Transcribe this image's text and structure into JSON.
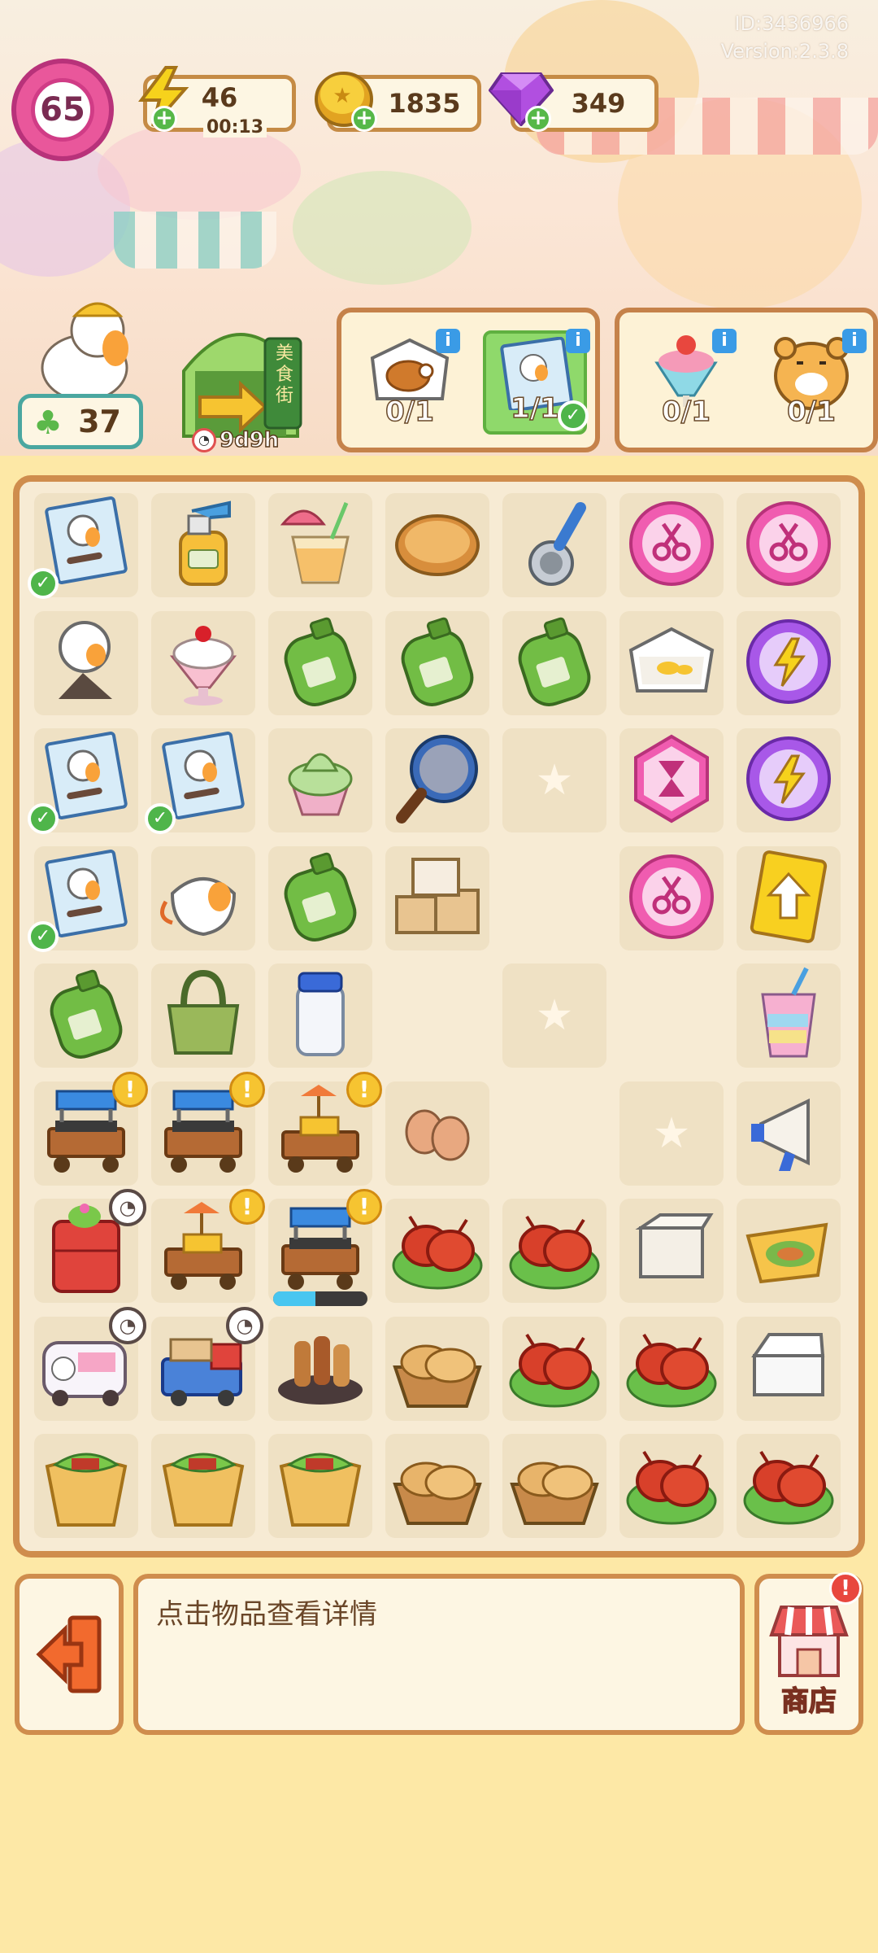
{
  "header": {
    "player_id": "ID:3436966",
    "version": "Version:2.3.8",
    "level": "65",
    "energy": {
      "value": "46",
      "timer": "00:13"
    },
    "coins": "1835",
    "gems": "349"
  },
  "profile": {
    "clover_count": "37"
  },
  "event": {
    "sign_text": "美食街",
    "timer": "9d9h"
  },
  "orders": [
    {
      "slots": [
        {
          "item": "takeout-chicken-icon",
          "progress": "0/1"
        },
        {
          "item": "recipe-card-icon",
          "progress": "1/1",
          "complete": true
        }
      ]
    },
    {
      "slots": [
        {
          "item": "strawberry-parfait-icon",
          "progress": "0/1"
        },
        {
          "item": "tiger-customer-icon",
          "progress": "0/1"
        }
      ]
    }
  ],
  "board": {
    "rows": [
      [
        "recipe-card-icon",
        "spray-bottle-icon",
        "tropical-drink-icon",
        "pie-icon",
        "ice-cream-scoop-icon",
        "scissors-orb-icon",
        "scissors-orb-icon"
      ],
      [
        "duck-lamp-icon",
        "sundae-icon",
        "gas-canister-icon",
        "gas-canister-icon",
        "gas-canister-icon",
        "takeout-box-icon",
        "energy-orb-icon"
      ],
      [
        "recipe-card-icon",
        "recipe-card-icon",
        "matcha-ice-cream-icon",
        "frying-pan-icon",
        "empty",
        "hourglass-hex-icon",
        "energy-orb-icon"
      ],
      [
        "recipe-card-icon",
        "duck-mask-icon",
        "gas-canister-icon",
        "cardboard-boxes-icon",
        "none",
        "scissors-orb-icon",
        "upgrade-card-icon"
      ],
      [
        "gas-canister-icon",
        "shopping-bag-icon",
        "milk-jar-icon",
        "none",
        "empty",
        "none",
        "rainbow-drink-icon"
      ],
      [
        "bbq-cart-icon",
        "bbq-cart-icon",
        "stove-cart-icon",
        "eggs-icon",
        "none",
        "empty",
        "megaphone-icon"
      ],
      [
        "red-fridge-icon",
        "stove-cart-icon",
        "bbq-cart-icon",
        "crayfish-plate-icon",
        "crayfish-plate-icon",
        "small-box-icon",
        "omelet-wrap-icon"
      ],
      [
        "ice-cream-van-icon",
        "delivery-truck-icon",
        "skewers-icon",
        "pancake-basket-icon",
        "crayfish-plate-icon",
        "crayfish-plate-icon",
        "foam-box-icon"
      ],
      [
        "wrap-icon",
        "wrap-icon",
        "wrap-icon",
        "pancake-basket-icon",
        "pancake-basket-icon",
        "crayfish-plate-icon",
        "crayfish-plate-icon"
      ]
    ],
    "bbq_progress": 0.45
  },
  "footer": {
    "hint": "点击物品查看详情",
    "shop_label": "商店"
  },
  "colors": {
    "board_border": "#cf8d4d",
    "level_pink": "#e9579b",
    "accent_green": "#56b848"
  }
}
